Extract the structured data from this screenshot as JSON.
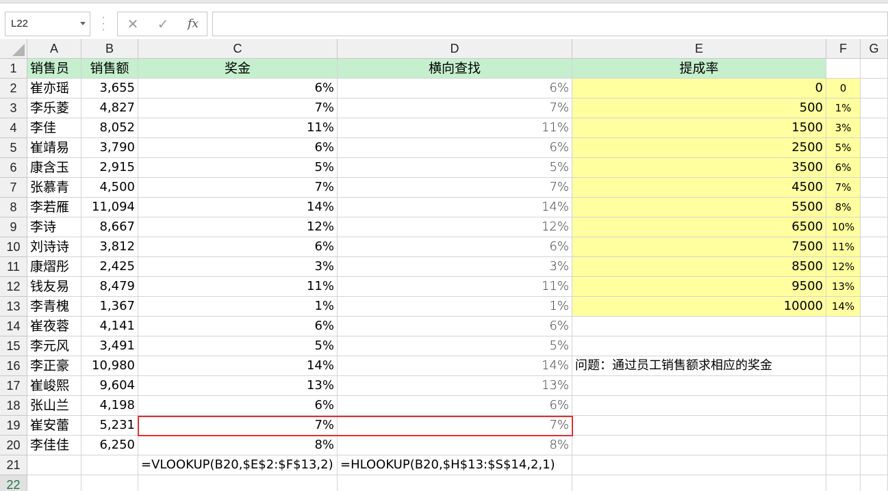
{
  "namebox": {
    "value": "L22"
  },
  "formula_bar": {
    "fx_label": "fx",
    "cancel_icon": "✕",
    "enter_icon": "✓",
    "value": ""
  },
  "columns": [
    "A",
    "B",
    "C",
    "D",
    "E",
    "F",
    "G"
  ],
  "headers": {
    "a": "销售员",
    "b": "销售额",
    "c": "奖金",
    "d": "横向查找",
    "e": "提成率"
  },
  "rows": [
    {
      "row": "2",
      "name": "崔亦瑶",
      "sales": "3,655",
      "bonus": "6%",
      "lookup": "6%",
      "threshold": "0",
      "rate": "0"
    },
    {
      "row": "3",
      "name": "李乐菱",
      "sales": "4,827",
      "bonus": "7%",
      "lookup": "7%",
      "threshold": "500",
      "rate": "1%"
    },
    {
      "row": "4",
      "name": "李佳",
      "sales": "8,052",
      "bonus": "11%",
      "lookup": "11%",
      "threshold": "1500",
      "rate": "3%"
    },
    {
      "row": "5",
      "name": "崔靖易",
      "sales": "3,790",
      "bonus": "6%",
      "lookup": "6%",
      "threshold": "2500",
      "rate": "5%"
    },
    {
      "row": "6",
      "name": "康含玉",
      "sales": "2,915",
      "bonus": "5%",
      "lookup": "5%",
      "threshold": "3500",
      "rate": "6%"
    },
    {
      "row": "7",
      "name": "张慕青",
      "sales": "4,500",
      "bonus": "7%",
      "lookup": "7%",
      "threshold": "4500",
      "rate": "7%"
    },
    {
      "row": "8",
      "name": "李若雁",
      "sales": "11,094",
      "bonus": "14%",
      "lookup": "14%",
      "threshold": "5500",
      "rate": "8%"
    },
    {
      "row": "9",
      "name": "李诗",
      "sales": "8,667",
      "bonus": "12%",
      "lookup": "12%",
      "threshold": "6500",
      "rate": "10%"
    },
    {
      "row": "10",
      "name": "刘诗诗",
      "sales": "3,812",
      "bonus": "6%",
      "lookup": "6%",
      "threshold": "7500",
      "rate": "11%"
    },
    {
      "row": "11",
      "name": "康熠彤",
      "sales": "2,425",
      "bonus": "3%",
      "lookup": "3%",
      "threshold": "8500",
      "rate": "12%"
    },
    {
      "row": "12",
      "name": "钱友易",
      "sales": "8,479",
      "bonus": "11%",
      "lookup": "11%",
      "threshold": "9500",
      "rate": "13%"
    },
    {
      "row": "13",
      "name": "李青槐",
      "sales": "1,367",
      "bonus": "1%",
      "lookup": "1%",
      "threshold": "10000",
      "rate": "14%"
    },
    {
      "row": "14",
      "name": "崔夜蓉",
      "sales": "4,141",
      "bonus": "6%",
      "lookup": "6%",
      "threshold": "",
      "rate": ""
    },
    {
      "row": "15",
      "name": "李元风",
      "sales": "3,491",
      "bonus": "5%",
      "lookup": "5%",
      "threshold": "",
      "rate": ""
    },
    {
      "row": "16",
      "name": "李正豪",
      "sales": "10,980",
      "bonus": "14%",
      "lookup": "14%",
      "threshold": "问题：通过员工销售额求相应的奖金",
      "rate": ""
    },
    {
      "row": "17",
      "name": "崔峻熙",
      "sales": "9,604",
      "bonus": "13%",
      "lookup": "13%",
      "threshold": "",
      "rate": ""
    },
    {
      "row": "18",
      "name": "张山兰",
      "sales": "4,198",
      "bonus": "6%",
      "lookup": "6%",
      "threshold": "",
      "rate": ""
    },
    {
      "row": "19",
      "name": "崔安蕾",
      "sales": "5,231",
      "bonus": "7%",
      "lookup": "7%",
      "threshold": "",
      "rate": ""
    },
    {
      "row": "20",
      "name": "李佳佳",
      "sales": "6,250",
      "bonus": "8%",
      "lookup": "8%",
      "threshold": "",
      "rate": ""
    }
  ],
  "row21": {
    "row": "21",
    "c": "=VLOOKUP(B20,$E$2:$F$13,2)",
    "d": "=HLOOKUP(B20,$H$13:$S$14,2,1)"
  },
  "row22": {
    "row": "22"
  },
  "colors": {
    "header_green": "#c6efce",
    "table_yellow": "#ffff9f",
    "highlight_red": "#e03030",
    "selected_row": "#217346"
  }
}
